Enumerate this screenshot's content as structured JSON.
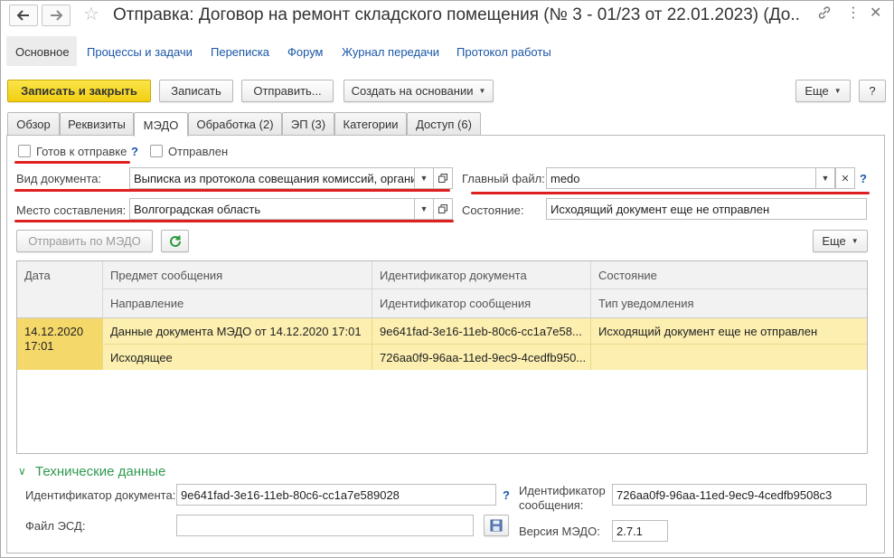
{
  "window": {
    "title": "Отправка: Договор на ремонт складского помещения (№ 3 - 01/23 от 22.01.2023) (До..."
  },
  "links": [
    "Основное",
    "Процессы и задачи",
    "Переписка",
    "Форум",
    "Журнал передачи",
    "Протокол работы"
  ],
  "toolbar": {
    "save_close": "Записать и закрыть",
    "save": "Записать",
    "send": "Отправить...",
    "create_based": "Создать на основании",
    "more": "Еще",
    "help": "?"
  },
  "tabs": [
    "Обзор",
    "Реквизиты",
    "МЭДО",
    "Обработка (2)",
    "ЭП (3)",
    "Категории",
    "Доступ (6)"
  ],
  "form": {
    "ready_label": "Готов к отправке",
    "ready_checked": false,
    "sent_label": "Отправлен",
    "sent_checked": false,
    "help": "?",
    "doc_type_label": "Вид документа:",
    "doc_type_value": "Выписка из протокола совещания комиссий, органи",
    "main_file_label": "Главный файл:",
    "main_file_value": "medo",
    "place_label": "Место составления:",
    "place_value": "Волгоградская область",
    "state_label": "Состояние:",
    "state_value": "Исходящий документ еще не отправлен",
    "send_medo": "Отправить по МЭДО",
    "more": "Еще"
  },
  "table": {
    "headers_top": [
      "Дата",
      "Предмет сообщения",
      "Идентификатор документа",
      "Состояние"
    ],
    "headers_bottom": [
      "Направление",
      "Идентификатор сообщения",
      "Тип уведомления"
    ],
    "rows": [
      {
        "date": "14.12.2020",
        "time": "17:01",
        "subject": "Данные документа МЭДО от 14.12.2020 17:01",
        "doc_id": "9e641fad-3e16-11eb-80c6-cc1a7e58...",
        "state": "Исходящий документ еще не отправлен",
        "direction": "Исходящее",
        "msg_id": "726aa0f9-96aa-11ed-9ec9-4cedfb950...",
        "notice_type": ""
      }
    ]
  },
  "tech": {
    "section": "Технические данные",
    "doc_id_label": "Идентификатор документа:",
    "doc_id_value": "9e641fad-3e16-11eb-80c6-cc1a7e589028",
    "msg_id_label_1": "Идентификатор",
    "msg_id_label_2": "сообщения:",
    "msg_id_value": "726aa0f9-96aa-11ed-9ec9-4cedfb9508c3",
    "esd_label": "Файл ЭСД:",
    "esd_value": "",
    "version_label": "Версия МЭДО:",
    "version_value": "2.7.1",
    "help": "?"
  },
  "colors": {
    "accent_yellow": "#f2cf12",
    "link_blue": "#1a57a7",
    "selected_row": "#fcefb0",
    "red_underline": "#e02020",
    "section_green": "#2f9a4e"
  }
}
